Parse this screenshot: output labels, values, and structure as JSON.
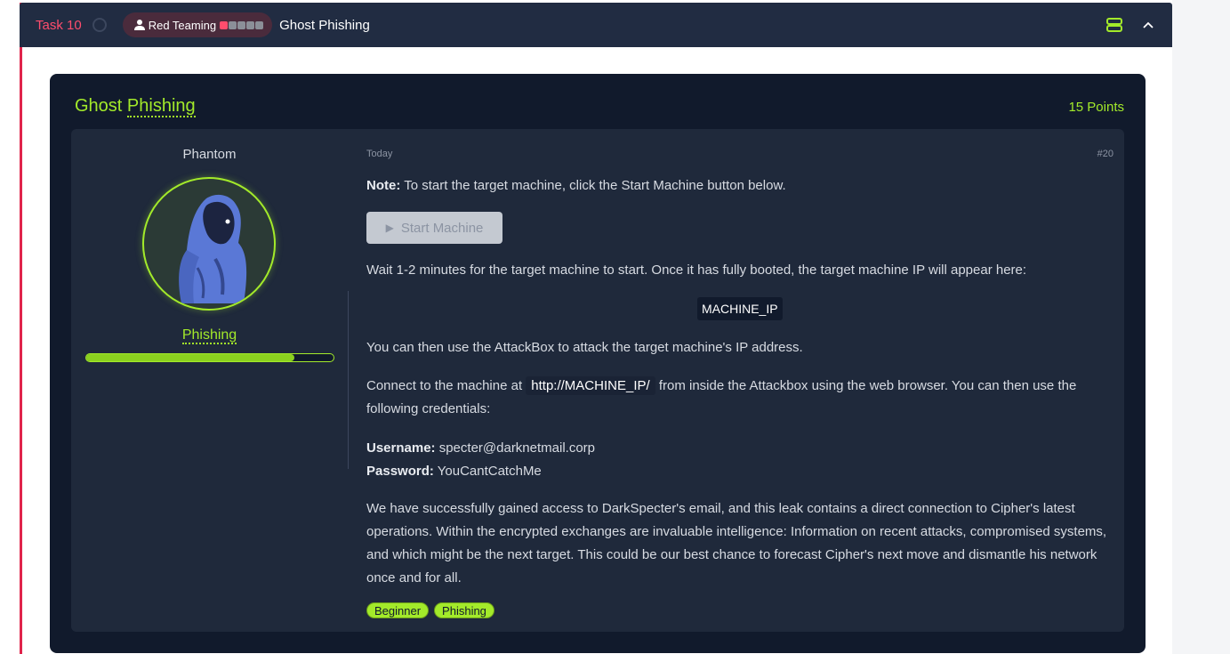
{
  "task": {
    "number": "Task 10",
    "room_pill_label": "Red Teaming",
    "difficulty_active": 1,
    "difficulty_total": 5,
    "title": "Ghost Phishing",
    "accent_color": "#e0244c"
  },
  "card": {
    "title_prefix": "Ghost",
    "title_link": "Phishing",
    "points": "15 Points",
    "accent_color": "#a3ea2a"
  },
  "author": {
    "name": "Phantom",
    "rank": "Phishing",
    "progress_fraction": 0.84
  },
  "post": {
    "date": "Today",
    "number": "#20",
    "note_label": "Note:",
    "note_text": " To start the target machine, click the Start Machine button below.",
    "start_button": "Start Machine",
    "wait_text": "Wait 1-2 minutes for the target machine to start. Once it has fully booted, the target machine IP will appear here:",
    "machine_ip": "MACHINE_IP",
    "attackbox_text": "You can then use the AttackBox to attack the target machine's IP address.",
    "connect_pre": "Connect to the machine at ",
    "connect_url": "http://MACHINE_IP/",
    "connect_post": " from inside the Attackbox using the web browser. You can then use the following credentials:",
    "username_label": "Username:",
    "username_value": " specter@darknetmail.corp",
    "password_label": "Password:",
    "password_value": " YouCantCatchMe",
    "story": "We have successfully gained access to DarkSpecter's email, and this leak contains a direct connection to Cipher's latest operations. Within the encrypted exchanges are invaluable intelligence: Information on recent attacks, compromised systems, and which might be the next target. This could be our best chance to forecast Cipher's next move and dismantle his network once and for all.",
    "tags": [
      "Beginner",
      "Phishing"
    ]
  }
}
